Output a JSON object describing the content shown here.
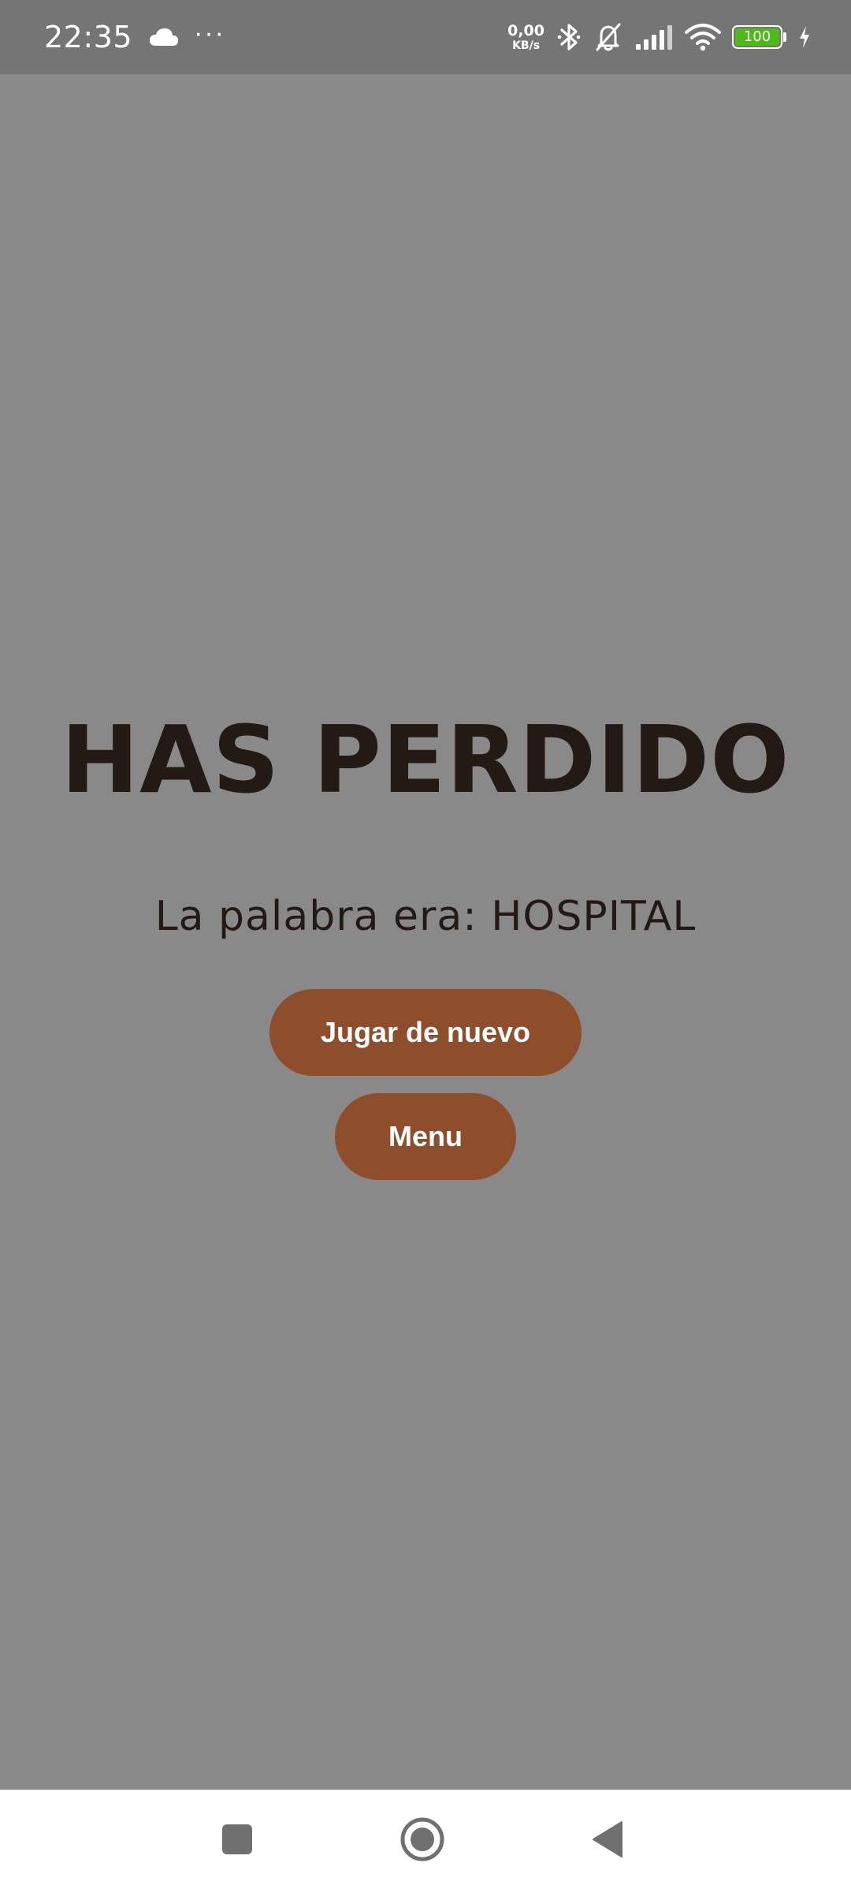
{
  "status_bar": {
    "time": "22:35",
    "weather_icon": "cloud-icon",
    "more_indicator": "···",
    "net_speed_value": "0,00",
    "net_speed_unit": "KB/s",
    "battery_level": "100",
    "icons": [
      "bluetooth-icon",
      "bell-off-icon",
      "signal-icon",
      "wifi-icon",
      "battery-icon",
      "charging-icon"
    ],
    "battery_color": "#4cbb17"
  },
  "game_over": {
    "title": "HAS PERDIDO",
    "word_message": "La palabra era: HOSPITAL",
    "play_again_label": "Jugar de nuevo",
    "menu_label": "Menu"
  },
  "colors": {
    "background": "#898989",
    "text": "#231a15",
    "button": "#8f4e2b",
    "button_text": "#ffffff"
  },
  "nav_bar": {
    "buttons": [
      "recents-icon",
      "home-icon",
      "back-icon"
    ]
  }
}
